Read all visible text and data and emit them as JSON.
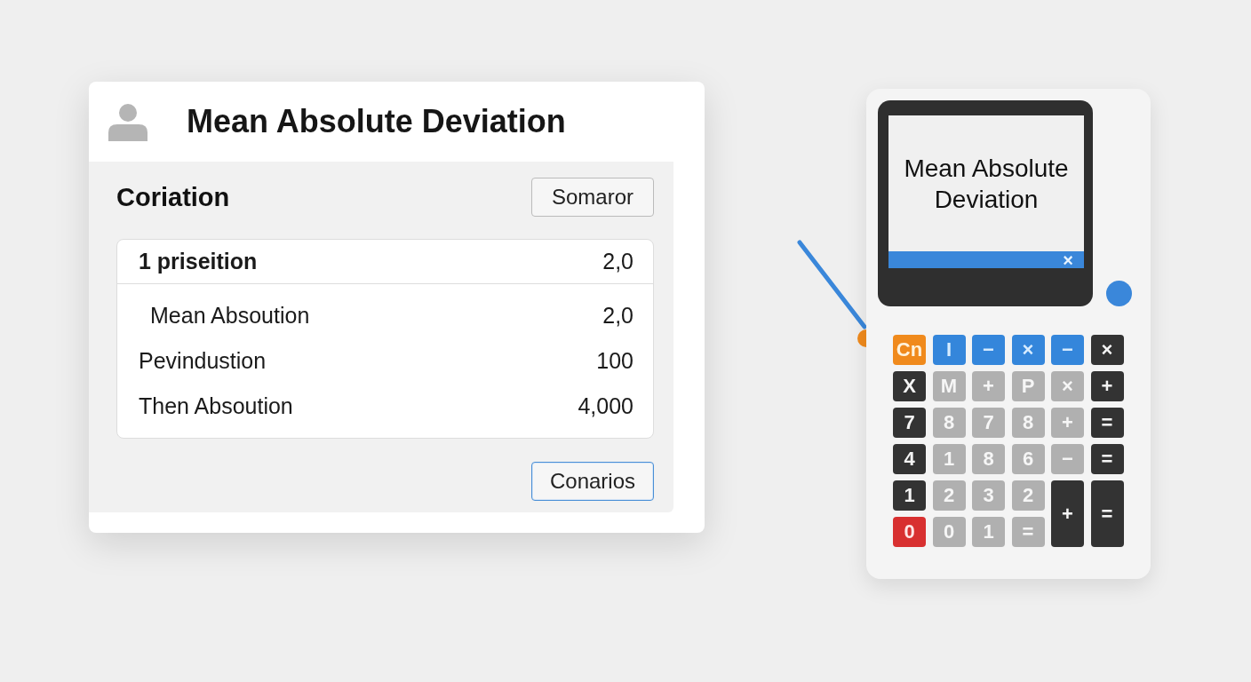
{
  "card": {
    "title": "Mean Absolute Deviation",
    "section": {
      "title": "Coriation",
      "action": "Somaror"
    },
    "rows": [
      {
        "kind": "header",
        "label": "1 priseition",
        "value": "2,0"
      },
      {
        "kind": "subitem",
        "label": "Mean Absoution",
        "value": "2,0"
      },
      {
        "kind": "item",
        "label": "Pevindustion",
        "value": "100"
      },
      {
        "kind": "item",
        "label": "Then Absoution",
        "value": "4,000"
      }
    ],
    "footer_button": "Conarios"
  },
  "calculator": {
    "display": {
      "text": "Mean Absolute Deviation",
      "close": "×"
    },
    "keys": [
      {
        "label": "Cn",
        "kind": "orange",
        "tall": false
      },
      {
        "label": "I",
        "kind": "blue",
        "tall": false
      },
      {
        "label": "−",
        "kind": "blue",
        "tall": false
      },
      {
        "label": "×",
        "kind": "blue",
        "tall": false
      },
      {
        "label": "−",
        "kind": "blue",
        "tall": false
      },
      {
        "label": "×",
        "kind": "dark",
        "tall": false
      },
      {
        "label": "X",
        "kind": "dark",
        "tall": false
      },
      {
        "label": "M",
        "kind": "gray",
        "tall": false
      },
      {
        "label": "+",
        "kind": "gray",
        "tall": false
      },
      {
        "label": "P",
        "kind": "gray",
        "tall": false
      },
      {
        "label": "×",
        "kind": "gray",
        "tall": false
      },
      {
        "label": "+",
        "kind": "dark",
        "tall": false
      },
      {
        "label": "7",
        "kind": "dark",
        "tall": false
      },
      {
        "label": "8",
        "kind": "gray",
        "tall": false
      },
      {
        "label": "7",
        "kind": "gray",
        "tall": false
      },
      {
        "label": "8",
        "kind": "gray",
        "tall": false
      },
      {
        "label": "+",
        "kind": "gray",
        "tall": false
      },
      {
        "label": "=",
        "kind": "dark",
        "tall": false
      },
      {
        "label": "4",
        "kind": "dark",
        "tall": false
      },
      {
        "label": "1",
        "kind": "gray",
        "tall": false
      },
      {
        "label": "8",
        "kind": "gray",
        "tall": false
      },
      {
        "label": "6",
        "kind": "gray",
        "tall": false
      },
      {
        "label": "−",
        "kind": "gray",
        "tall": false
      },
      {
        "label": "=",
        "kind": "dark",
        "tall": false
      },
      {
        "label": "1",
        "kind": "dark",
        "tall": false
      },
      {
        "label": "2",
        "kind": "gray",
        "tall": false
      },
      {
        "label": "3",
        "kind": "gray",
        "tall": false
      },
      {
        "label": "2",
        "kind": "gray",
        "tall": false
      },
      {
        "label": "+",
        "kind": "dark",
        "tall": true
      },
      {
        "label": "=",
        "kind": "dark",
        "tall": true
      },
      {
        "label": "0",
        "kind": "red",
        "tall": false
      },
      {
        "label": "0",
        "kind": "gray",
        "tall": false
      },
      {
        "label": "1",
        "kind": "gray",
        "tall": false
      },
      {
        "label": "=",
        "kind": "gray",
        "tall": false
      }
    ]
  }
}
